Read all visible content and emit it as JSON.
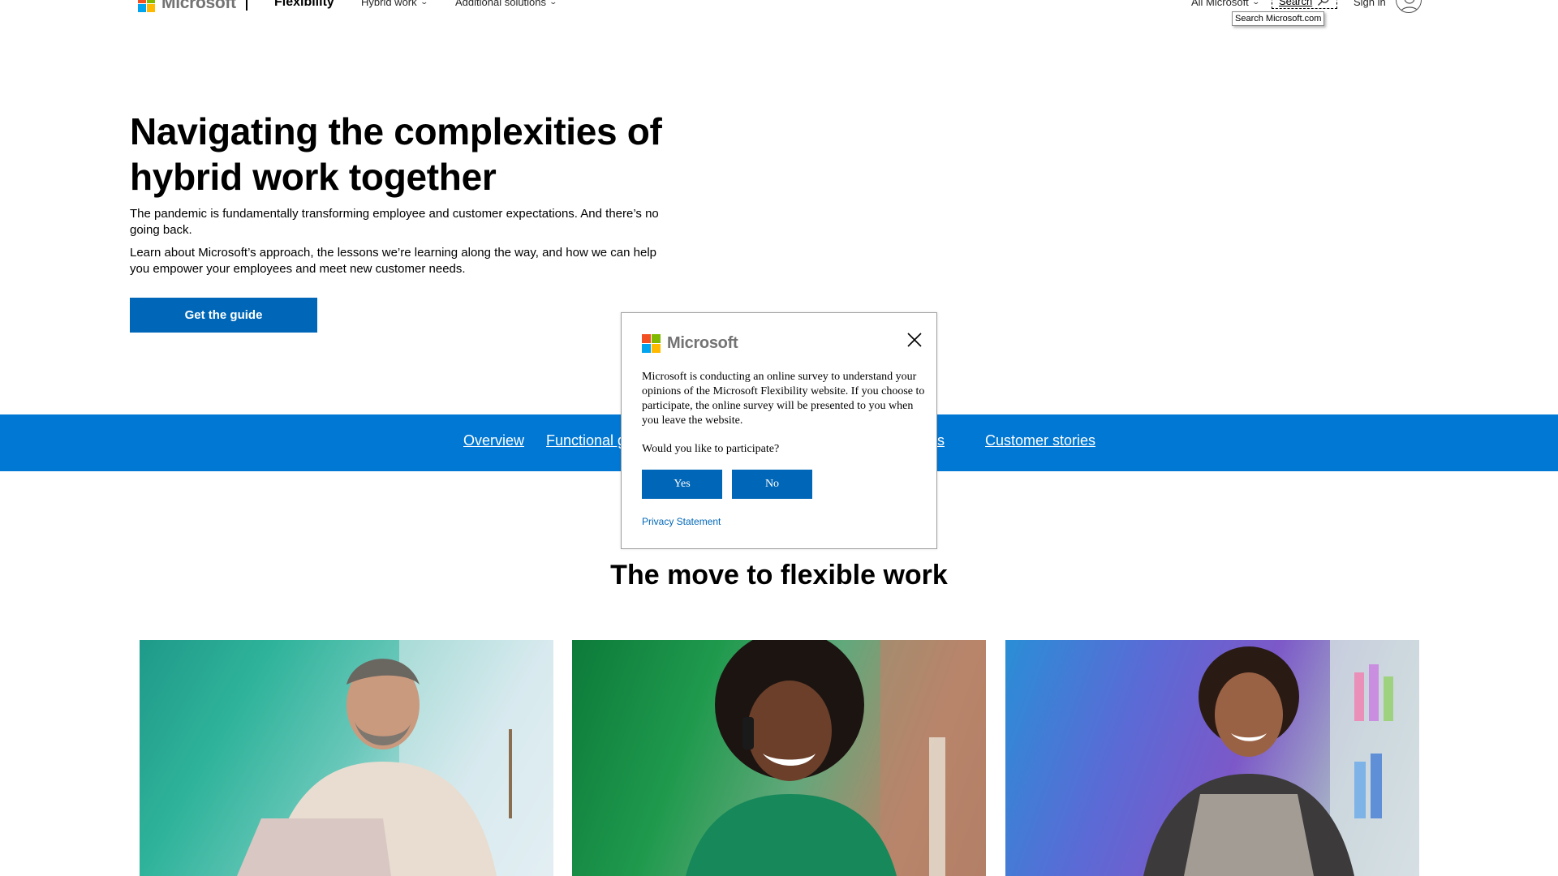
{
  "header": {
    "logo_text": "Microsoft",
    "brand": "Flexibility",
    "nav": [
      {
        "label": "Hybrid work"
      },
      {
        "label": "Additional solutions"
      }
    ],
    "all_microsoft": "All Microsoft",
    "search_label": "Search",
    "search_tooltip": "Search Microsoft.com",
    "sign_in": "Sign in",
    "icons": {
      "chevron": "chevron-down-icon",
      "search": "search-icon",
      "avatar": "user-avatar-icon"
    }
  },
  "hero": {
    "title_line1": "Navigating the complexities of",
    "title_line2": "hybrid work together",
    "paragraph1": "The pandemic is fundamentally transforming employee and customer expectations. And there’s no going back.",
    "paragraph2": "Learn about Microsoft’s approach, the lessons we’re learning along the way, and how we can help you empower your employees and meet new customer needs.",
    "cta": "Get the guide"
  },
  "tabs": {
    "items": [
      {
        "label": "Overview"
      },
      {
        "label": "Functional g"
      },
      {
        "label": "ides"
      },
      {
        "label": "Customer stories"
      }
    ]
  },
  "section": {
    "title": "The move to flexible work"
  },
  "dialog": {
    "logo_text": "Microsoft",
    "body": "Microsoft is conducting an online survey to understand your opinions of the Microsoft Flexibility website. If you choose to participate, the online survey will be presented to you when you leave the website.",
    "question": "Would you like to participate?",
    "yes": "Yes",
    "no": "No",
    "privacy": "Privacy Statement"
  },
  "colors": {
    "accent_blue": "#0067b8",
    "band_blue": "#0078d4",
    "ms_red": "#f25022",
    "ms_green": "#7fba00",
    "ms_blue": "#00a4ef",
    "ms_yellow": "#ffb900"
  }
}
